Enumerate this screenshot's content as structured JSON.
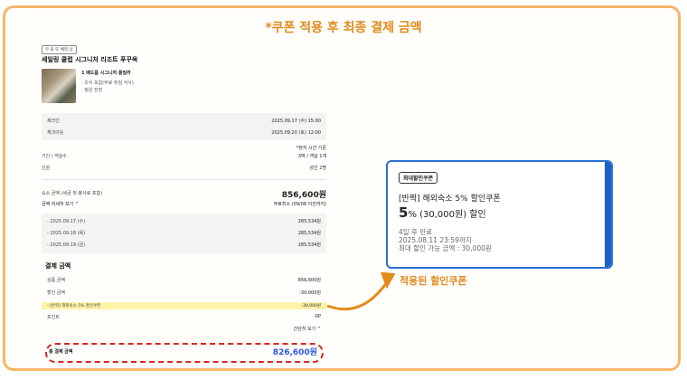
{
  "headline": "*쿠폰 적용 후 최종 결제 금액",
  "hotel": {
    "tag": "무 료 또 예약 상",
    "name": "세일링 클럽 시그니처 리조트 푸꾸옥",
    "room_name": "1 베드룸 시그니처 풀빌라",
    "room_detail_1": "· 조식 포함(무료 취침 식사)",
    "room_detail_2": "· 정원 전망"
  },
  "dates": {
    "checkin_label": "체크인",
    "checkin_value": "2025.09.17 (수) 15:00",
    "checkout_label": "체크아웃",
    "checkout_value": "2025.09.20 (토) 12:00"
  },
  "note_local_time": "*현지 시간 기준",
  "period": {
    "label": "기간 / 객실수",
    "value": "3박 / 객실 1개"
  },
  "guests": {
    "label": "인원",
    "value": "성인 2명"
  },
  "stay_amount": {
    "label": "숙소 금액 (세금 및 봉사료 포함)",
    "value": "856,600원",
    "details_toggle": "금액 자세히 보기 ^",
    "free_cancel": "무료취소 (09/08 이전까지)"
  },
  "nights": [
    {
      "date": "- 2025.09.17 (수)",
      "price": "285,534원"
    },
    {
      "date": "- 2025.09.18 (목)",
      "price": "285,534원"
    },
    {
      "date": "- 2025.09.19 (금)",
      "price": "285,534원"
    }
  ],
  "payment": {
    "title": "결제 금액",
    "product_label": "상품 금액",
    "product_value": "856,600원",
    "discount_label": "할인 금액",
    "discount_value": "-30,000원",
    "coupon_line_label": "- [반짝] 해외숙소 5% 할인쿠폰",
    "coupon_line_value": "-30,000원",
    "points_label": "포인트",
    "points_value": "-0P",
    "toggle": "간단히 보기 ^",
    "total_label": "총 결제 금액",
    "total_value": "826,600원"
  },
  "coupon": {
    "tag": "최대할인쿠폰",
    "title": "[반짝] 해외숙소 5% 할인쿠폰",
    "percent": "5",
    "percent_suffix": "% (30,000원) 할인",
    "expiry_1": "4일 후 만료",
    "expiry_2": "2025.08.11 23:59까지",
    "max_discount": "최대 할인 가능 금액 : 30,000원"
  },
  "caption": "적용된 할인쿠폰",
  "colors": {
    "accent": "#e38a1c",
    "frame": "#f7b66a",
    "coupon_blue": "#2a6fd6",
    "total_blue": "#2a55e5",
    "oval_red": "#d6261f"
  }
}
